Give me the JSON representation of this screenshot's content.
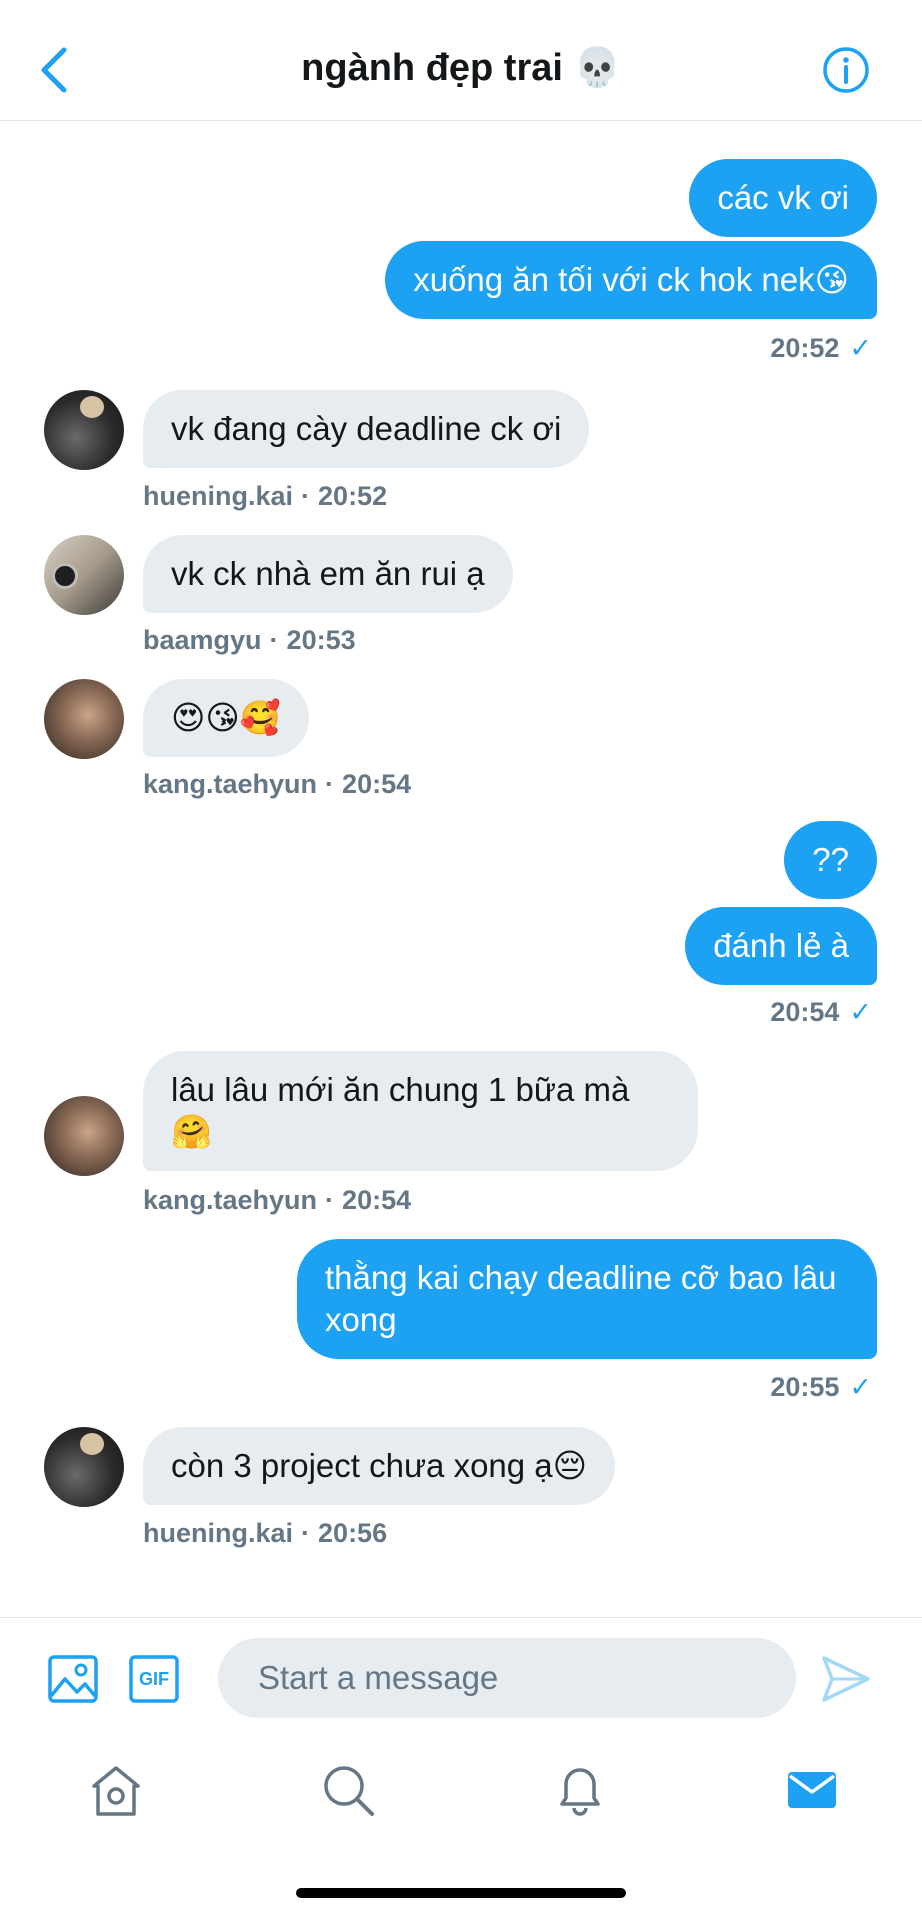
{
  "header": {
    "title": "ngành đẹp trai 💀"
  },
  "messages": [
    {
      "text": "các vk ơi"
    },
    {
      "text": "xuống ăn tối với ck hok nek😘"
    },
    {
      "time": "20:52"
    },
    {
      "text": "vk đang cày deadline ck ơi",
      "user": "huening.kai",
      "time": "20:52"
    },
    {
      "text": "vk ck nhà em ăn rui ạ",
      "user": "baamgyu",
      "time": "20:53"
    },
    {
      "text": "😍😘🥰",
      "user": "kang.taehyun",
      "time": "20:54"
    },
    {
      "text": "??"
    },
    {
      "text": "đánh lẻ à"
    },
    {
      "time": "20:54"
    },
    {
      "text": "lâu lâu mới ăn chung 1 bữa mà 🤗",
      "user": "kang.taehyun",
      "time": "20:54"
    },
    {
      "text": "thằng kai chạy deadline cỡ bao lâu xong"
    },
    {
      "time": "20:55"
    },
    {
      "text": "còn 3 project chưa xong ạ😔",
      "user": "huening.kai",
      "time": "20:56"
    }
  ],
  "composer": {
    "placeholder": "Start a message",
    "gif_label": "GIF"
  },
  "colors": {
    "accent": "#1da1f2",
    "incoming_bubble": "#e6ecf0",
    "meta_text": "#657786"
  },
  "icons": [
    "back-chevron-icon",
    "info-icon",
    "image-icon",
    "gif-icon",
    "send-icon",
    "home-icon",
    "search-icon",
    "notifications-icon",
    "messages-icon"
  ]
}
